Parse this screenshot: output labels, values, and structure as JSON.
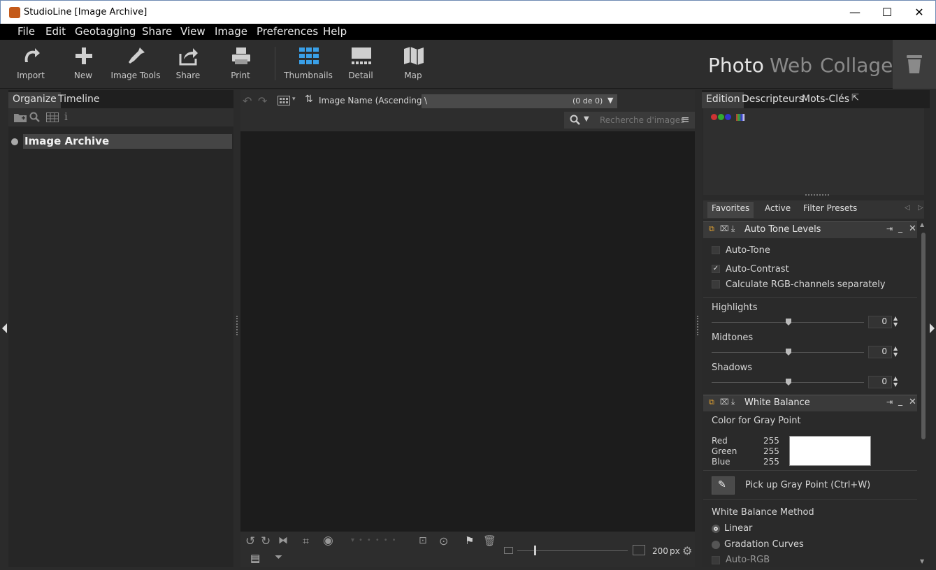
{
  "window": {
    "title": "StudioLine [Image Archive]",
    "minimize": "—",
    "maximize": "☐",
    "close": "✕"
  },
  "menu": [
    "File",
    "Edit",
    "Geotagging",
    "Share",
    "View",
    "Image",
    "Preferences",
    "Help"
  ],
  "toolbar": {
    "import": "Import",
    "new": "New",
    "image_tools": "Image Tools",
    "share": "Share",
    "print": "Print",
    "thumbnails": "Thumbnails",
    "detail": "Detail",
    "map": "Map"
  },
  "modes": {
    "photo": "Photo",
    "web": "Web",
    "collage": "Collage"
  },
  "left": {
    "tabs": [
      "Organize",
      "Timeline"
    ],
    "tree_root": "Image Archive"
  },
  "center": {
    "sort_label": "Image Name (Ascending)",
    "path": "\\",
    "count": "(0 de 0)",
    "search_placeholder": "Recherche d'images",
    "zoom_value": "200",
    "zoom_unit": "px"
  },
  "right": {
    "tabs": [
      "Edition",
      "Descripteurs",
      "Mots-Clés"
    ],
    "filter_tabs": [
      "Favorites",
      "Active",
      "Filter Presets"
    ],
    "auto_tone": {
      "title": "Auto Tone Levels",
      "auto_tone": "Auto-Tone",
      "auto_contrast": "Auto-Contrast",
      "calc_rgb": "Calculate RGB-channels separately",
      "highlights": "Highlights",
      "highlights_val": "0",
      "midtones": "Midtones",
      "midtones_val": "0",
      "shadows": "Shadows",
      "shadows_val": "0"
    },
    "white_balance": {
      "title": "White Balance",
      "gray_point_label": "Color for Gray Point",
      "red": "Red",
      "red_val": "255",
      "green": "Green",
      "green_val": "255",
      "blue": "Blue",
      "blue_val": "255",
      "pickup": "Pick up Gray Point (Ctrl+W)",
      "method_label": "White Balance Method",
      "linear": "Linear",
      "gradation": "Gradation Curves",
      "auto_rgb": "Auto-RGB"
    }
  },
  "colors": {
    "accent_blue": "#3aa0e8",
    "panel_bg": "#2a2a2a",
    "menubar_bg": "#000000"
  }
}
